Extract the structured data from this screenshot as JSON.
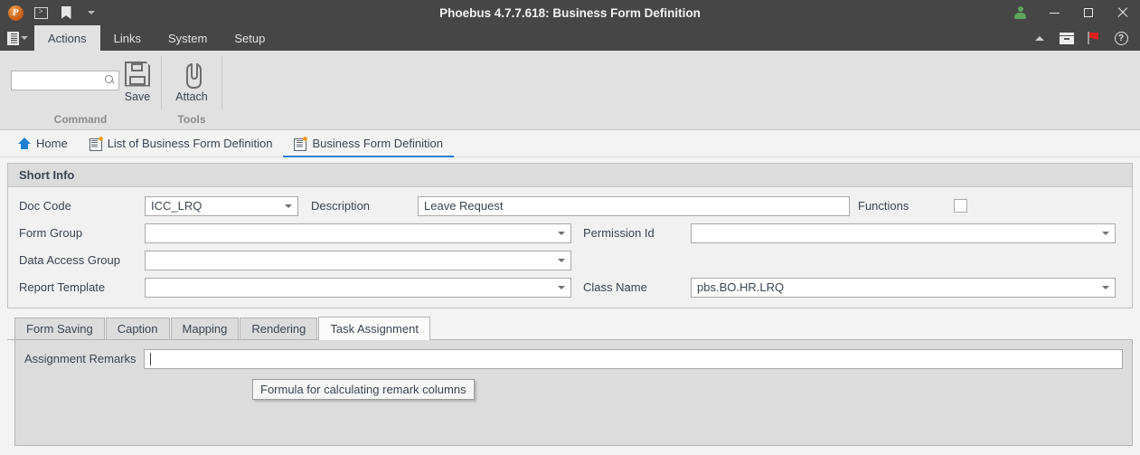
{
  "titlebar": {
    "app_title": "Phoebus 4.7.7.618: Business Form Definition",
    "logo_letter": "P",
    "quick_access": [
      {
        "name": "console-icon",
        "glyph": ">"
      },
      {
        "name": "bookmark-icon",
        "glyph": ""
      },
      {
        "name": "chevron-down-icon",
        "glyph": ""
      }
    ],
    "window_controls": [
      {
        "name": "user-account-icon",
        "label": ""
      },
      {
        "name": "minimize-button",
        "label": ""
      },
      {
        "name": "maximize-button",
        "label": ""
      },
      {
        "name": "close-button",
        "label": ""
      }
    ]
  },
  "menubar": {
    "app_menu_icon": "document-menu-icon",
    "tabs": [
      {
        "label": "Actions",
        "active": true
      },
      {
        "label": "Links",
        "active": false
      },
      {
        "label": "System",
        "active": false
      },
      {
        "label": "Setup",
        "active": false
      }
    ],
    "right_icons": [
      {
        "name": "collapse-ribbon-icon"
      },
      {
        "name": "archive-box-icon"
      },
      {
        "name": "red-flag-icon"
      },
      {
        "name": "help-icon",
        "glyph": "?"
      }
    ]
  },
  "ribbon": {
    "groups": [
      {
        "label": "Command",
        "search": {
          "value": "",
          "placeholder": ""
        },
        "buttons": [
          {
            "label": "Save",
            "icon": "save-floppy-icon"
          }
        ]
      },
      {
        "label": "Tools",
        "buttons": [
          {
            "label": "Attach",
            "icon": "paperclip-icon"
          }
        ]
      }
    ]
  },
  "breadcrumbs": [
    {
      "label": "Home",
      "icon": "home-icon",
      "active": false
    },
    {
      "label": "List of Business Form Definition",
      "icon": "form-document-icon",
      "active": false
    },
    {
      "label": "Business Form Definition",
      "icon": "form-document-icon",
      "active": true
    }
  ],
  "short_info": {
    "title": "Short Info",
    "fields": {
      "doc_code_label": "Doc Code",
      "doc_code_value": "ICC_LRQ",
      "description_label": "Description",
      "description_value": "Leave Request",
      "functions_label": "Functions",
      "functions_checked": false,
      "form_group_label": "Form Group",
      "form_group_value": "",
      "permission_id_label": "Permission Id",
      "permission_id_value": "",
      "data_access_group_label": "Data Access Group",
      "data_access_group_value": "",
      "report_template_label": "Report Template",
      "report_template_value": "",
      "class_name_label": "Class Name",
      "class_name_value": "pbs.BO.HR.LRQ"
    }
  },
  "subtabs": [
    {
      "label": "Form Saving",
      "active": false
    },
    {
      "label": "Caption",
      "active": false
    },
    {
      "label": "Mapping",
      "active": false
    },
    {
      "label": "Rendering",
      "active": false
    },
    {
      "label": "Task Assignment",
      "active": true
    }
  ],
  "task_assignment": {
    "assignment_remarks_label": "Assignment Remarks",
    "assignment_remarks_value": "",
    "tooltip_text": "Formula for calculating remark columns"
  },
  "colors": {
    "titlebar_bg": "#464646",
    "ribbon_bg": "#e1e1e1",
    "accent_blue": "#1f7fd0",
    "panel_header_bg": "#dcdcdc",
    "flag_red": "#e02020",
    "user_green": "#5ea35e",
    "badge_orange": "#f2a01e"
  }
}
